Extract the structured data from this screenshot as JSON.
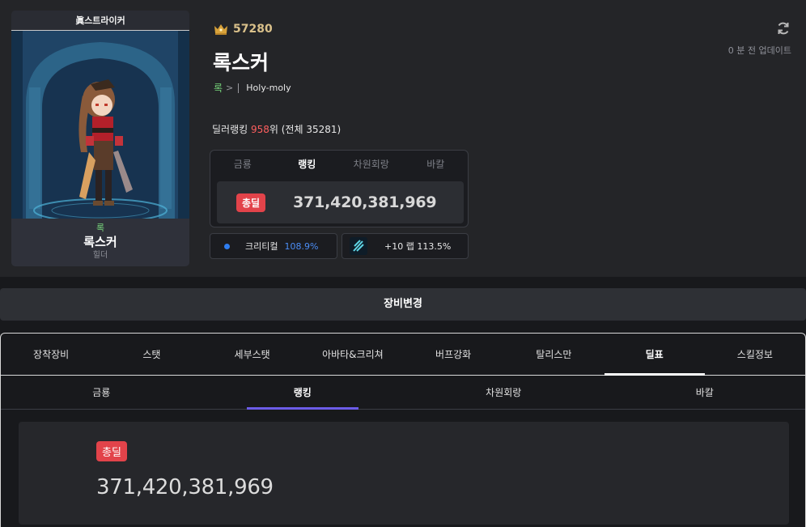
{
  "card": {
    "server_title": "眞스트라이커",
    "job": "록",
    "name": "록스커",
    "guild_label": "힐더"
  },
  "header": {
    "rank_number": "57280",
    "character_name": "록스커",
    "job": "록",
    "guild": "Holy-moly",
    "updated": "0 분 전 업데이트"
  },
  "dealer_ranking": {
    "prefix": "딜러랭킹 ",
    "rank": "958",
    "suffix": "위 (전체 35281)"
  },
  "mini_panel": {
    "tabs": [
      "금룡",
      "랭킹",
      "차원회랑",
      "바칼"
    ],
    "active_tab": "랭킹",
    "badge": "총딜",
    "total_damage": "371,420,381,969"
  },
  "stats": {
    "crit_label": "크리티컬",
    "crit_value": "108.9%",
    "weapon_text": "+10 랩 113.5%"
  },
  "equip_button": "장비변경",
  "main_tabs": [
    "장착장비",
    "스탯",
    "세부스탯",
    "아바타&크리쳐",
    "버프강화",
    "탈리스만",
    "딜표",
    "스킬정보"
  ],
  "main_active": "딜표",
  "sub_tabs": [
    "금룡",
    "랭킹",
    "차원회랑",
    "바칼"
  ],
  "sub_active": "랭킹",
  "result": {
    "badge": "총딜",
    "total_damage": "371,420,381,969"
  },
  "colors": {
    "badge_red": "#e2434a",
    "rank_red": "#ff5f5f",
    "job_green": "#76d47a",
    "crit_blue": "#4b8df5",
    "sub_tab_accent": "#6b5ce7"
  }
}
